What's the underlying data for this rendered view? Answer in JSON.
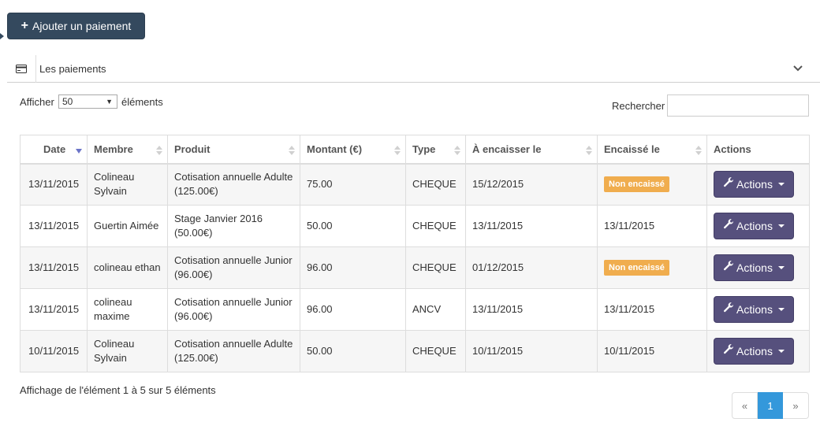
{
  "toolbar": {
    "add_label": "Ajouter un paiement",
    "add_icon": "plus-icon"
  },
  "panel": {
    "title": "Les paiements",
    "icon": "credit-card-icon",
    "toggle_icon": "chevron-down-icon"
  },
  "length_menu": {
    "prefix": "Afficher",
    "value": "50",
    "suffix": "éléments"
  },
  "search": {
    "label": "Rechercher",
    "value": ""
  },
  "table": {
    "columns": [
      "Date",
      "Membre",
      "Produit",
      "Montant (€)",
      "Type",
      "À encaisser le",
      "Encaissé le",
      "Actions"
    ],
    "sorted_column": "Date",
    "rows": [
      {
        "date": "13/11/2015",
        "member": [
          "Colineau",
          "Sylvain"
        ],
        "product": [
          "Cotisation annuelle Adulte",
          "(125.00€)"
        ],
        "amount": "75.00",
        "type": "CHEQUE",
        "due": "15/12/2015",
        "cashed": "Non encaissé",
        "cashed_is_badge": true,
        "action": "Actions"
      },
      {
        "date": "13/11/2015",
        "member": [
          "Guertin Aimée"
        ],
        "product": [
          "Stage Janvier 2016",
          "(50.00€)"
        ],
        "amount": "50.00",
        "type": "CHEQUE",
        "due": "13/11/2015",
        "cashed": "13/11/2015",
        "cashed_is_badge": false,
        "action": "Actions"
      },
      {
        "date": "13/11/2015",
        "member": [
          "colineau ethan"
        ],
        "product": [
          "Cotisation annuelle Junior",
          "(96.00€)"
        ],
        "amount": "96.00",
        "type": "CHEQUE",
        "due": "01/12/2015",
        "cashed": "Non encaissé",
        "cashed_is_badge": true,
        "action": "Actions"
      },
      {
        "date": "13/11/2015",
        "member": [
          "colineau",
          "maxime"
        ],
        "product": [
          "Cotisation annuelle Junior",
          "(96.00€)"
        ],
        "amount": "96.00",
        "type": "ANCV",
        "due": "13/11/2015",
        "cashed": "13/11/2015",
        "cashed_is_badge": false,
        "action": "Actions"
      },
      {
        "date": "10/11/2015",
        "member": [
          "Colineau",
          "Sylvain"
        ],
        "product": [
          "Cotisation annuelle Adulte",
          "(125.00€)"
        ],
        "amount": "50.00",
        "type": "CHEQUE",
        "due": "10/11/2015",
        "cashed": "10/11/2015",
        "cashed_is_badge": false,
        "action": "Actions"
      }
    ]
  },
  "info": "Affichage de l'élément 1 à 5 sur 5 éléments",
  "pagination": {
    "prev": "«",
    "current": "1",
    "next": "»"
  },
  "colors": {
    "primary_dark": "#34495e",
    "action_button": "#56507d",
    "badge_warning": "#f0ad4e",
    "page_active": "#3498db"
  }
}
